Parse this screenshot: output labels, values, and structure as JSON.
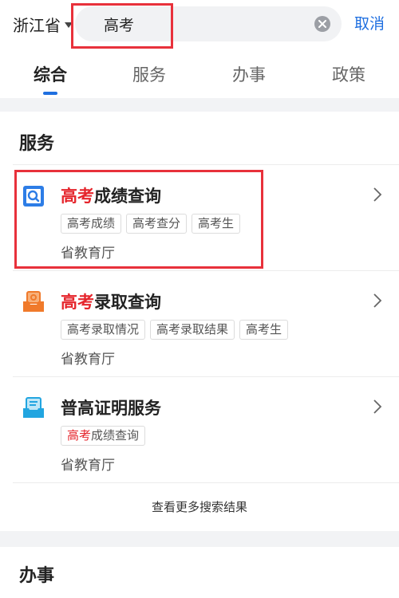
{
  "header": {
    "region": "浙江省",
    "search_value": "高考",
    "cancel_label": "取消",
    "tabs": [
      {
        "label": "综合",
        "active": true
      },
      {
        "label": "服务",
        "active": false
      },
      {
        "label": "办事",
        "active": false
      },
      {
        "label": "政策",
        "active": false
      }
    ]
  },
  "services": {
    "title": "服务",
    "items": [
      {
        "keyword": "高考",
        "title_rest": "成绩查询",
        "icon": "magnifier-document-icon",
        "tags": [
          {
            "keyword": "",
            "rest": "高考成绩"
          },
          {
            "keyword": "",
            "rest": "高考查分"
          },
          {
            "keyword": "",
            "rest": "高考生"
          }
        ],
        "department": "省教育厅"
      },
      {
        "keyword": "高考",
        "title_rest": "录取查询",
        "icon": "inbox-tray-icon",
        "tags": [
          {
            "keyword": "",
            "rest": "高考录取情况"
          },
          {
            "keyword": "",
            "rest": "高考录取结果"
          },
          {
            "keyword": "",
            "rest": "高考生"
          }
        ],
        "department": "省教育厅"
      },
      {
        "keyword": "",
        "title_rest": "普高证明服务",
        "icon": "certificate-tray-icon",
        "tags": [
          {
            "keyword": "高考",
            "rest": "成绩查询"
          }
        ],
        "department": "省教育厅"
      }
    ],
    "more_label": "查看更多搜索结果"
  },
  "affairs": {
    "title": "办事"
  },
  "colors": {
    "accent": "#1f6fe0",
    "keyword": "#e5252c",
    "annotation_box": "#e8313b",
    "icon_blue": "#2d7de6",
    "icon_orange": "#f07a2b",
    "icon_cyan": "#22a5e0"
  }
}
